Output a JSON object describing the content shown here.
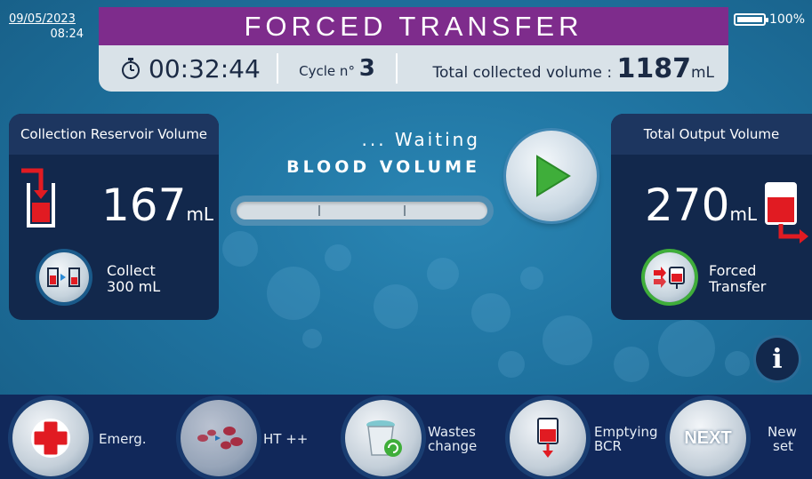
{
  "status": {
    "date": "09/05/2023",
    "time": "08:24",
    "battery": "100%",
    "battery_level": 1.0
  },
  "header": {
    "title": "FORCED TRANSFER",
    "timer": "00:32:44",
    "cycle_label": "Cycle n°",
    "cycle_value": "3",
    "total_label": "Total collected volume :",
    "total_value": "1187",
    "total_unit": "mL"
  },
  "left_panel": {
    "title": "Collection Reservoir Volume",
    "volume": "167",
    "unit": "mL",
    "button_line1": "Collect",
    "button_line2": "300 mL"
  },
  "center": {
    "status": "... Waiting",
    "label": "BLOOD VOLUME"
  },
  "right_panel": {
    "title": "Total Output Volume",
    "volume": "270",
    "unit": "mL",
    "button_line1": "Forced",
    "button_line2": "Transfer"
  },
  "info_label": "i",
  "bottom": {
    "emerg": "Emerg.",
    "ht": "HT ++",
    "wastes_line1": "Wastes",
    "wastes_line2": "change",
    "emptying_line1": "Emptying",
    "emptying_line2": "BCR",
    "next": "NEXT",
    "newset_line1": "New",
    "newset_line2": "set"
  },
  "colors": {
    "title_bar": "#7e2c8c",
    "panel": "#12284c",
    "play": "#3fae3a",
    "emergency": "#e11b22"
  }
}
